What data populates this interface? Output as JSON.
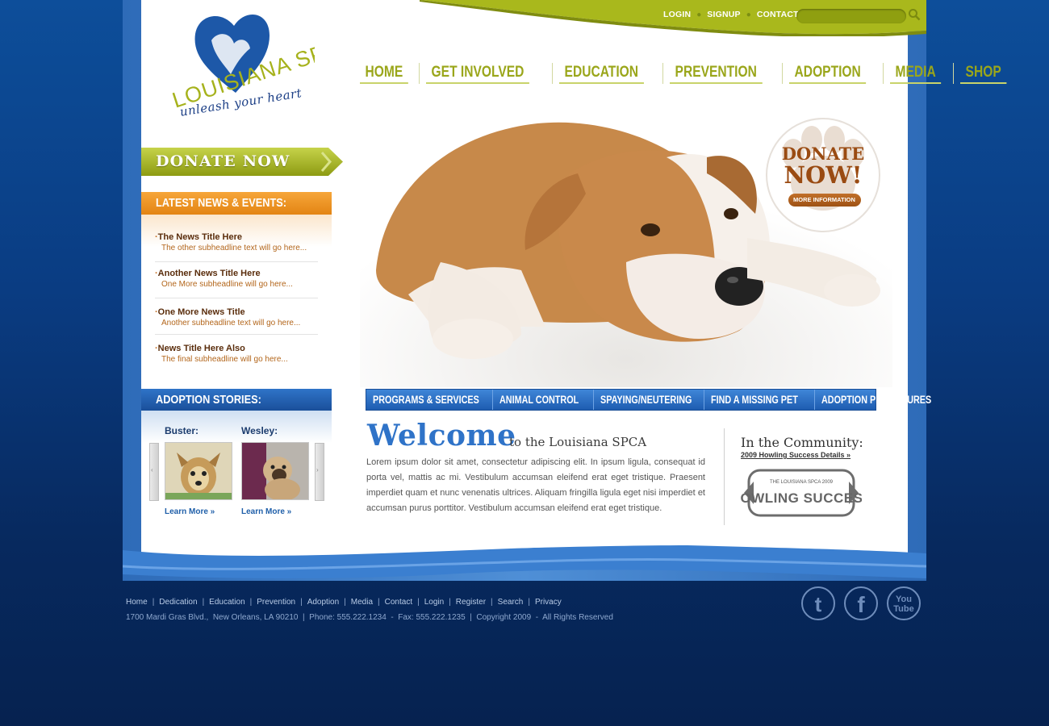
{
  "toplinks": {
    "login": "LOGIN",
    "signup": "SIGNUP",
    "contact": "CONTACT"
  },
  "logo": {
    "name": "LOUISIANA SPCA",
    "tagline": "unleash your heart"
  },
  "mainnav": [
    "HOME",
    "GET INVOLVED",
    "EDUCATION",
    "PREVENTION",
    "ADOPTION",
    "MEDIA",
    "SHOP"
  ],
  "donate": {
    "label": "DONATE NOW"
  },
  "news": {
    "header": "LATEST NEWS & EVENTS:",
    "items": [
      {
        "title": "The News Title Here",
        "sub": "The other subheadline text will go here..."
      },
      {
        "title": "Another News Title Here",
        "sub": "One More subheadline will go here..."
      },
      {
        "title": "One More News Title",
        "sub": "Another subheadline text will go here..."
      },
      {
        "title": "News Title Here Also",
        "sub": "The final subheadline will go here..."
      }
    ]
  },
  "adoption": {
    "header": "ADOPTION STORIES:",
    "pets": [
      {
        "name": "Buster:",
        "link": "Learn More »"
      },
      {
        "name": "Wesley:",
        "link": "Learn More »"
      }
    ]
  },
  "badge": {
    "title_1": "DONATE",
    "title_2": "NOW!",
    "button": "MORE INFORMATION"
  },
  "subnav": [
    "PROGRAMS & SERVICES",
    "ANIMAL CONTROL",
    "SPAYING/NEUTERING",
    "FIND A MISSING PET",
    "ADOPTION PROCEDURES"
  ],
  "welcome": {
    "title": "Welcome",
    "sub": "to the Louisiana SPCA",
    "body": "Lorem ipsum dolor sit amet, consectetur adipiscing elit. In ipsum ligula, consequat id porta vel, mattis ac mi. Vestibulum accumsan eleifend erat eget tristique. Praesent imperdiet quam et nunc venenatis ultrices. Aliquam fringilla ligula eget nisi imperdiet et accumsan purus porttitor. Vestibulum accumsan eleifend erat eget tristique."
  },
  "community": {
    "title": "In the Community:",
    "link": "2009 Howling Success Details »",
    "logo_top": "THE LOUISIANA SPCA 2009",
    "logo_main": "HOWLING SUCCESS"
  },
  "footer": {
    "links": [
      "Home",
      "Dedication",
      "Education",
      "Prevention",
      "Adoption",
      "Media",
      "Contact",
      "Login",
      "Register",
      "Search",
      "Privacy"
    ],
    "address": "1700 Mardi Gras Blvd.,  New Orleans, LA 90210  |  Phone: 555.222.1234  -  Fax: 555.222.1235  |  Copyright 2009  -  All Rights Reserved"
  },
  "social": {
    "twitter": "t",
    "facebook": "f",
    "youtube_1": "You",
    "youtube_2": "Tube"
  },
  "colors": {
    "accent_green": "#9aa61a",
    "accent_orange": "#e38413",
    "accent_blue": "#2f73c8",
    "background": "#0a3c82"
  }
}
